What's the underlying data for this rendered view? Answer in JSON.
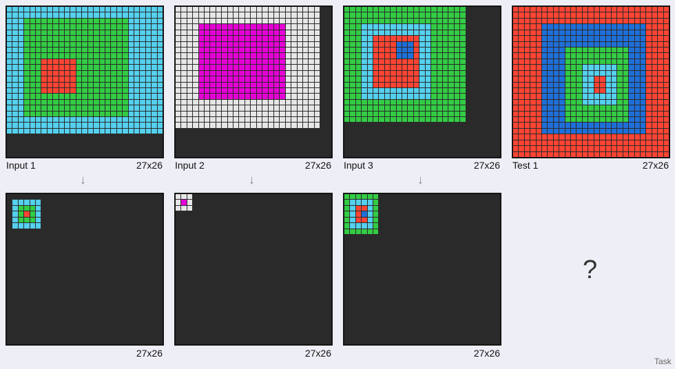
{
  "palette": {
    "0": "#2a2a2a",
    "1": "#1f6fd8",
    "2": "#ff4433",
    "3": "#33cc44",
    "6": "#e600d6",
    "8": "#55d0ee",
    "9": "#e6e6e6"
  },
  "pairs": [
    {
      "input_label": "Input 1",
      "input_size": "27x26",
      "output_size": "27x26",
      "input_grid": "888888888888888888888888888|888888888888888888888888888|888333333333333333333888888|888333333333333333333888888|888333333333333333333888888|888333333333333333333888888|888333333333333333333888888|888333333333333333333888888|888333333333333333333888888|888333222222333333333888888|888333222222333333333888888|888333222222333333333888888|888333222222333333333888888|888333222222333333333888888|888333222222333333333888888|888333333333333333333888888|888333333333333333333888888|888333333333333333333888888|888333333333333333333888888|888888888888888888888888888|888888888888888888888888888|888888888888888888888888888|000000000000000000000000000|000000000000000000000000000|000000000000000000000000000|000000000000000000000000000",
      "output_grid": "000000000000000000000000000|088888000000000000000000000|083338000000000000000000000|083238000000000000000000000|083338000000000000000000000|088888000000000000000000000|000000000000000000000000000|000000000000000000000000000|000000000000000000000000000|000000000000000000000000000|000000000000000000000000000|000000000000000000000000000|000000000000000000000000000|000000000000000000000000000|000000000000000000000000000|000000000000000000000000000|000000000000000000000000000|000000000000000000000000000|000000000000000000000000000|000000000000000000000000000|000000000000000000000000000|000000000000000000000000000|000000000000000000000000000|000000000000000000000000000|000000000000000000000000000|000000000000000000000000000"
    },
    {
      "input_label": "Input 2",
      "input_size": "27x26",
      "output_size": "27x26",
      "input_grid": "999999999999999999999999900|999999999999999999999999900|999999999999999999999999900|999966666666666666699999900|999966666666666666699999900|999966666666666666699999900|999966666666666666699999900|999966666666666666699999900|999966666666666666699999900|999966666666666666699999900|999966666666666666699999900|999966666666666666699999900|999966666666666666699999900|999966666666666666699999900|999966666666666666699999900|999966666666666666699999900|999999999999999999999999900|999999999999999999999999900|999999999999999999999999900|999999999999999999999999900|999999999999999999999999900|000000000000000000000000000|000000000000000000000000000|000000000000000000000000000|000000000000000000000000000|000000000000000000000000000",
      "output_grid": "999000000000000000000000000|969000000000000000000000000|999000000000000000000000000|000000000000000000000000000|000000000000000000000000000|000000000000000000000000000|000000000000000000000000000|000000000000000000000000000|000000000000000000000000000|000000000000000000000000000|000000000000000000000000000|000000000000000000000000000|000000000000000000000000000|000000000000000000000000000|000000000000000000000000000|000000000000000000000000000|000000000000000000000000000|000000000000000000000000000|000000000000000000000000000|000000000000000000000000000|000000000000000000000000000|000000000000000000000000000|000000000000000000000000000|000000000000000000000000000|000000000000000000000000000|000000000000000000000000000"
    },
    {
      "input_label": "Input 3",
      "input_size": "27x26",
      "output_size": "27x26",
      "input_grid": "333333333333333333333000000|333333333333333333333000000|333333333333333333333000000|333888888888888333333000000|333888888888888333333000000|333882222222288333333000000|333882222111288333333000000|333882222111288333333000000|333882222111288333333000000|333882222222288333333000000|333882222222288333333000000|333882222222288333333000000|333882222222288333333000000|333882222222288333333000000|333888888888888333333000000|333888888888888333333000000|333333333333333333333000000|333333333333333333333000000|333333333333333333333000000|333333333333333333333000000|000000000000000000000000000|000000000000000000000000000|000000000000000000000000000|000000000000000000000000000|000000000000000000000000000|000000000000000000000000000",
      "output_grid": "333333000000000000000000000|388883000000000000000000000|382283000000000000000000000|382183000000000000000000000|382283000000000000000000000|388883000000000000000000000|333333000000000000000000000|000000000000000000000000000|000000000000000000000000000|000000000000000000000000000|000000000000000000000000000|000000000000000000000000000|000000000000000000000000000|000000000000000000000000000|000000000000000000000000000|000000000000000000000000000|000000000000000000000000000|000000000000000000000000000|000000000000000000000000000|000000000000000000000000000|000000000000000000000000000|000000000000000000000000000|000000000000000000000000000|000000000000000000000000000|000000000000000000000000000|000000000000000000000000000"
    }
  ],
  "test": {
    "label": "Test 1",
    "size": "27x26",
    "grid": "222222222222222222222222222|222222222222222222222222222|222222222222222222222222222|222221111111111111111112222|222221111111111111111112222|222221111111111111111112222|222221111111111111111112222|222221111333333333331112222|222221111333333333331112222|222221111333333333331112222|222221111333888888331112222|222221111333888888331112222|222221111333882288331112222|222221111333882288331112222|222221111333882288331112222|222221111333888888331112222|222221111333888888331112222|222221111333333333331112222|222221111333333333331112222|222221111333333333331112222|222221111111111111111112222|222221111111111111111112222|222222222222222222222222222|222222222222222222222222222|222222222222222222222222222|222222222222222222222222222"
  },
  "unknown_mark": "?",
  "footer": "Task",
  "arrow": "↓"
}
